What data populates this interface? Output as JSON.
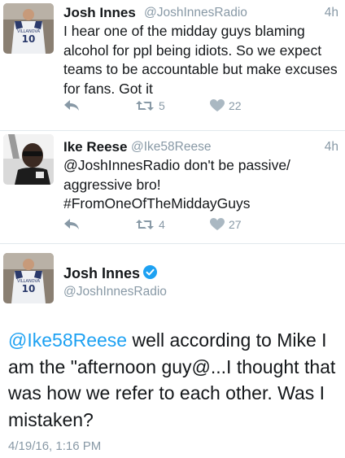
{
  "tweets": [
    {
      "name": "Josh Innes",
      "handle": "@JoshInnesRadio",
      "time": "4h",
      "text": "I hear one of the midday guys blaming alcohol for ppl being idiots. So we expect teams to be accountable but make excuses for fans. Got it",
      "retweets": "5",
      "likes": "22",
      "avatar_icon": "avatar-jersey"
    },
    {
      "name": "Ike Reese",
      "handle": "@Ike58Reese",
      "time": "4h",
      "text": "@JoshInnesRadio don't be passive/ aggressive bro! #FromOneOfTheMiddayGuys",
      "retweets": "4",
      "likes": "27",
      "avatar_icon": "avatar-photo"
    }
  ],
  "detail": {
    "name": "Josh Innes",
    "handle": "@JoshInnesRadio",
    "mention": "@Ike58Reese",
    "text": " well according to Mike I am the \"afternoon guy@...I thought that was how we refer to each other. Was I mistaken?",
    "date": "4/19/16, 1:16 PM",
    "verified_icon": "verified-badge-icon"
  },
  "colors": {
    "accent": "#1da1f2",
    "muted": "#8899a6",
    "text": "#14171a",
    "divider": "#e1e8ed"
  }
}
